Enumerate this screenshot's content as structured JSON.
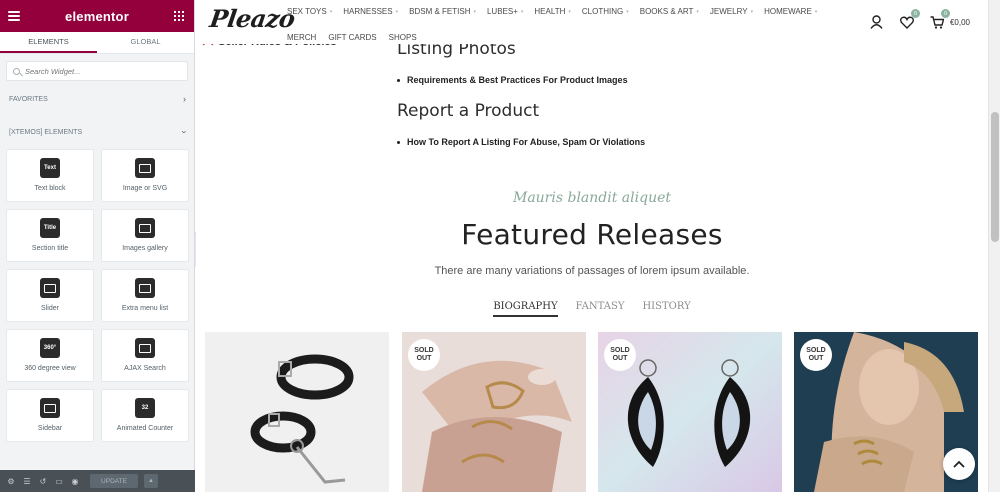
{
  "panel": {
    "logo": "elementor",
    "tabs": [
      "ELEMENTS",
      "GLOBAL"
    ],
    "search_placeholder": "Search Widget...",
    "sections": [
      "FAVORITES",
      "[XTEMOS] ELEMENTS"
    ],
    "widgets": [
      {
        "label": "Text block",
        "icon": "text-block-icon",
        "glyph": "Text"
      },
      {
        "label": "Image or SVG",
        "icon": "image-svg-icon",
        "glyph": ""
      },
      {
        "label": "Section title",
        "icon": "section-title-icon",
        "glyph": "Title"
      },
      {
        "label": "Images gallery",
        "icon": "images-gallery-icon",
        "glyph": ""
      },
      {
        "label": "Slider",
        "icon": "slider-icon",
        "glyph": ""
      },
      {
        "label": "Extra menu list",
        "icon": "extra-menu-list-icon",
        "glyph": ""
      },
      {
        "label": "360 degree view",
        "icon": "360-view-icon",
        "glyph": "360°"
      },
      {
        "label": "AJAX Search",
        "icon": "ajax-search-icon",
        "glyph": ""
      },
      {
        "label": "Sidebar",
        "icon": "sidebar-icon",
        "glyph": ""
      },
      {
        "label": "Animated Counter",
        "icon": "animated-counter-icon",
        "glyph": "32"
      }
    ],
    "update_label": "UPDATE",
    "accent_color": "#93003c"
  },
  "site": {
    "brand": "Pleazo",
    "nav_row1": [
      "SEX TOYS",
      "HARNESSES",
      "BDSM & FETISH",
      "LUBES+",
      "HEALTH",
      "CLOTHING",
      "BOOKS & ART",
      "JEWELRY",
      "HOMEWARE"
    ],
    "nav_row2": [
      "MERCH",
      "GIFT CARDS",
      "SHOPS"
    ],
    "wishlist_count": "0",
    "cart_count": "0",
    "cart_value": "€0,00",
    "seller_rules": "Seller Rules & Policies",
    "sections": [
      {
        "heading": "Listing Photos",
        "item": "Requirements & Best Practices For Product Images"
      },
      {
        "heading": "Report a Product",
        "item": "How To Report A Listing For Abuse, Spam Or Violations"
      }
    ],
    "featured": {
      "eyebrow": "Mauris blandit aliquet",
      "title": "Featured Releases",
      "subtitle": "There are many variations of passages of lorem ipsum available.",
      "tabs": [
        "BIOGRAPHY",
        "FANTASY",
        "HISTORY"
      ],
      "active_tab": "BIOGRAPHY"
    },
    "products": [
      {
        "image": "leather-cuffs",
        "sold_out": false
      },
      {
        "image": "gold-finger-rings",
        "sold_out": true
      },
      {
        "image": "black-earrings",
        "sold_out": true
      },
      {
        "image": "woman-with-bracelet",
        "sold_out": true
      }
    ],
    "sold_out_label": "SOLD OUT",
    "accent_green": "#8aa99a"
  }
}
